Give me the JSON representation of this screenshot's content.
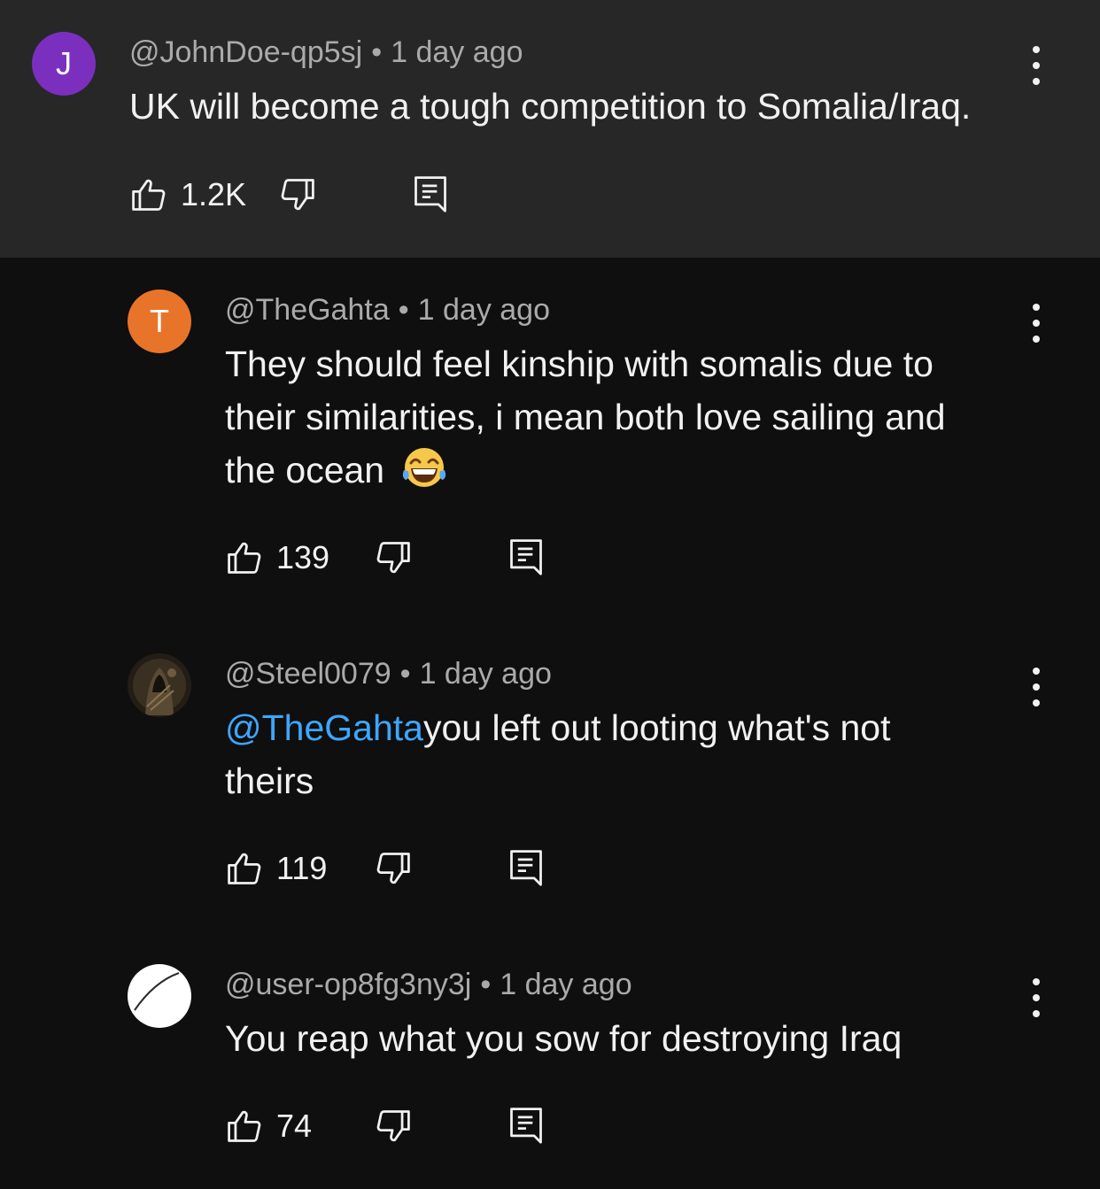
{
  "comments": [
    {
      "avatar_letter": "J",
      "avatar_color": "#7b2fbf",
      "handle": "@JohnDoe-qp5sj",
      "separator": "•",
      "time": "1 day ago",
      "text": "UK will become a tough competition to Somalia/Iraq.",
      "likes": "1.2K"
    },
    {
      "avatar_letter": "T",
      "avatar_color": "#e8742a",
      "handle": "@TheGahta",
      "separator": "•",
      "time": "1 day ago",
      "text_lines": [
        "They should feel kinship with somalis due to",
        "their similarities, i mean both love sailing and",
        "the ocean"
      ],
      "emoji": "face-with-tears-of-joy",
      "likes": "139"
    },
    {
      "avatar": "dark-hooded-figure-photo",
      "handle": "@Steel0079",
      "separator": "•",
      "time": "1 day ago",
      "mention": "@TheGahta",
      "text_line1": "you left out looting what's not",
      "text_line2": "theirs",
      "likes": "119"
    },
    {
      "avatar": "white-circle-with-slash",
      "handle": "@user-op8fg3ny3j",
      "separator": "•",
      "time": "1 day ago",
      "text": "You reap what you sow for destroying Iraq",
      "likes": "74"
    }
  ],
  "icons": {
    "like": "thumbs-up-icon",
    "dislike": "thumbs-down-icon",
    "reply": "reply-comment-icon",
    "more": "more-vertical-icon"
  },
  "colors": {
    "highlight_bg": "#272727",
    "bg": "#0f0f0f",
    "mention": "#3ea6ff",
    "meta_text": "#aaaaaa"
  }
}
